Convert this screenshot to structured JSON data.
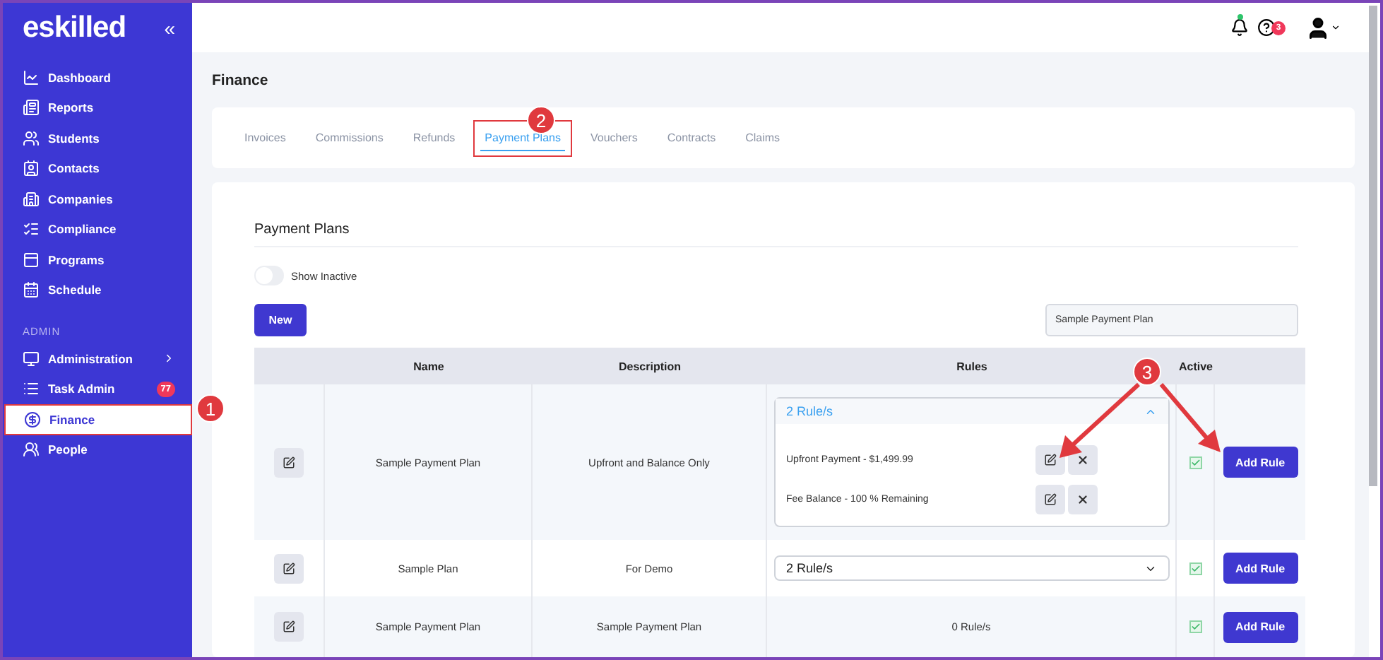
{
  "sidebar": {
    "logo": "eskilled",
    "collapse": "«",
    "items": [
      {
        "label": "Dashboard",
        "selected": false
      },
      {
        "label": "Reports",
        "selected": false
      },
      {
        "label": "Students",
        "selected": false
      },
      {
        "label": "Contacts",
        "selected": false
      },
      {
        "label": "Companies",
        "selected": false
      },
      {
        "label": "Compliance",
        "selected": false
      },
      {
        "label": "Programs",
        "selected": false
      },
      {
        "label": "Schedule",
        "selected": false
      }
    ],
    "admin_heading": "ADMIN",
    "admin_items": [
      {
        "label": "Administration",
        "selected": false,
        "has_submenu": true,
        "highlighted": false
      },
      {
        "label": "Task Admin",
        "selected": false,
        "badge": "77",
        "has_submenu": false,
        "highlighted": false
      },
      {
        "label": "Finance",
        "selected": true,
        "has_submenu": false,
        "highlighted": true
      },
      {
        "label": "People",
        "selected": false,
        "has_submenu": false,
        "highlighted": false
      }
    ]
  },
  "topbar": {
    "notification_dot": true,
    "help_badge": "3"
  },
  "page_title": "Finance",
  "tabs": [
    {
      "label": "Invoices",
      "selected": false,
      "highlighted": false
    },
    {
      "label": "Commissions",
      "selected": false,
      "highlighted": false
    },
    {
      "label": "Refunds",
      "selected": false,
      "highlighted": false
    },
    {
      "label": "Payment Plans",
      "selected": true,
      "highlighted": true
    },
    {
      "label": "Vouchers",
      "selected": false,
      "highlighted": false
    },
    {
      "label": "Contracts",
      "selected": false,
      "highlighted": false
    },
    {
      "label": "Claims",
      "selected": false,
      "highlighted": false
    }
  ],
  "panel": {
    "title": "Payment Plans",
    "toggle": {
      "label": "Show Inactive",
      "on": false
    },
    "new_button": "New",
    "search": {
      "value": "Sample Payment Plan"
    },
    "columns": [
      "Name",
      "Description",
      "Rules",
      "Active"
    ],
    "rows": [
      {
        "name": "Sample Payment Plan",
        "description": "Upfront and Balance Only",
        "rules": {
          "kind": "dropdown",
          "summary": "2 Rule/s",
          "expanded": true,
          "items": [
            "Upfront Payment - $1,499.99",
            "Fee Balance - 100 % Remaining"
          ]
        },
        "active": true,
        "action": "Add Rule"
      },
      {
        "name": "Sample Plan",
        "description": "For Demo",
        "rules": {
          "kind": "dropdown",
          "summary": "2 Rule/s",
          "expanded": false
        },
        "active": true,
        "action": "Add Rule"
      },
      {
        "name": "Sample Payment Plan",
        "description": "Sample Payment Plan",
        "rules": {
          "kind": "text",
          "summary": "0 Rule/s"
        },
        "active": true,
        "action": "Add Rule"
      }
    ]
  },
  "callouts": [
    {
      "label": "1"
    },
    {
      "label": "2"
    },
    {
      "label": "3"
    }
  ]
}
